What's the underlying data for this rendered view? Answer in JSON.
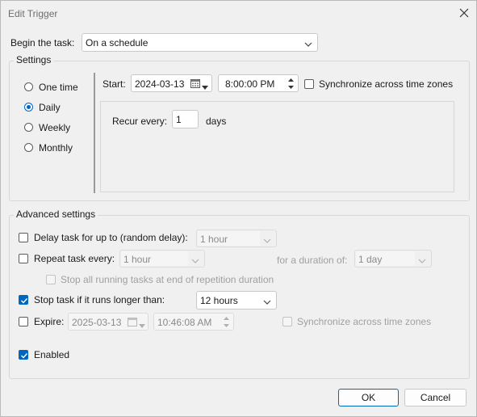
{
  "window": {
    "title": "Edit Trigger"
  },
  "begin": {
    "label": "Begin the task:",
    "value": "On a schedule"
  },
  "settings": {
    "legend": "Settings",
    "options": [
      "One time",
      "Daily",
      "Weekly",
      "Monthly"
    ],
    "selected": "Daily",
    "start_label": "Start:",
    "start_date": "2024-03-13",
    "start_time": "8:00:00 PM",
    "sync_label": "Synchronize across time zones",
    "recur_label": "Recur every:",
    "recur_value": "1",
    "recur_unit": "days"
  },
  "advanced": {
    "legend": "Advanced settings",
    "delay_label": "Delay task for up to (random delay):",
    "delay_value": "1 hour",
    "repeat_label": "Repeat task every:",
    "repeat_value": "1 hour",
    "duration_label": "for a duration of:",
    "duration_value": "1 day",
    "stop_all_label": "Stop all running tasks at end of repetition duration",
    "stop_label": "Stop task if it runs longer than:",
    "stop_value": "12 hours",
    "expire_label": "Expire:",
    "expire_date": "2025-03-13",
    "expire_time": "10:46:08 AM",
    "expire_sync_label": "Synchronize across time zones",
    "enabled_label": "Enabled"
  },
  "buttons": {
    "ok": "OK",
    "cancel": "Cancel"
  },
  "colors": {
    "accent": "#0067c0"
  }
}
